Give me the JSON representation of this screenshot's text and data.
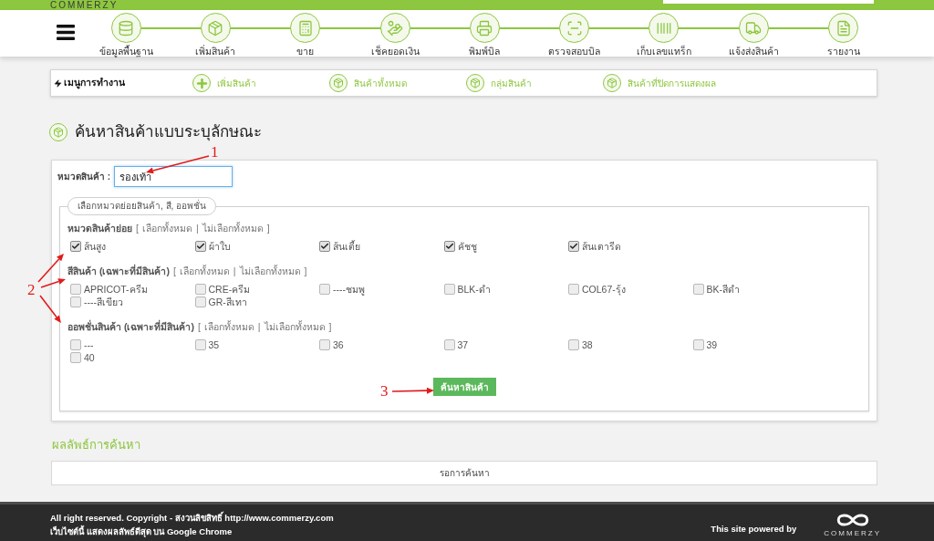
{
  "top_bar": {
    "logo": "COMMERZY"
  },
  "nav": {
    "items": [
      {
        "label": "ข้อมูลพื้นฐาน"
      },
      {
        "label": "เพิ่มสินค้า"
      },
      {
        "label": "ขาย"
      },
      {
        "label": "เช็คยอดเงิน"
      },
      {
        "label": "พิมพ์บิล"
      },
      {
        "label": "ตรวจสอบบิล"
      },
      {
        "label": "เก็บเลขแทร็ก"
      },
      {
        "label": "แจ้งส่งสินค้า"
      },
      {
        "label": "รายงาน"
      }
    ]
  },
  "work_menu": {
    "title": "เมนูการทำงาน",
    "items": [
      {
        "label": "เพิ่มสินค้า",
        "kind": "add"
      },
      {
        "label": "สินค้าทั้งหมด",
        "kind": "box"
      },
      {
        "label": "กลุ่มสินค้า",
        "kind": "box"
      },
      {
        "label": "สินค้าที่ปิดการแสดงผล",
        "kind": "box"
      }
    ]
  },
  "page_title": "ค้นหาสินค้าแบบระบุลักษณะ",
  "form": {
    "category_label": "หมวดสินค้า :",
    "category_value": "รองเท้า",
    "legend": "เลือกหมวดย่อยสินค้า, สี, ออพชั่น",
    "sections": [
      {
        "title": "หมวดสินค้าย่อย",
        "brackets": [
          "[",
          "|",
          "]"
        ],
        "select_all": "เลือกทั้งหมด",
        "select_none": "ไม่เลือกทั้งหมด",
        "options": [
          {
            "label": "ส้นสูง",
            "checked": true
          },
          {
            "label": "ผ้าใบ",
            "checked": true
          },
          {
            "label": "ส้นเตี้ย",
            "checked": true
          },
          {
            "label": "คัชชู",
            "checked": true
          },
          {
            "label": "ส้นเตารีด",
            "checked": true
          }
        ]
      },
      {
        "title": "สีสินค้า (เฉพาะที่มีสินค้า)",
        "brackets": [
          "[",
          "|",
          "]"
        ],
        "select_all": "เลือกทั้งหมด",
        "select_none": "ไม่เลือกทั้งหมด",
        "options": [
          {
            "label": "APRICOT-ครีม",
            "checked": false
          },
          {
            "label": "CRE-ครีม",
            "checked": false
          },
          {
            "label": "----ชมพู",
            "checked": false
          },
          {
            "label": "BLK-ดำ",
            "checked": false
          },
          {
            "label": "COL67-รุ้ง",
            "checked": false
          },
          {
            "label": "BK-สีดำ",
            "checked": false
          },
          {
            "label": "----สีเขียว",
            "checked": false
          },
          {
            "label": "GR-สีเทา",
            "checked": false
          }
        ]
      },
      {
        "title": "ออพชั่นสินค้า (เฉพาะที่มีสินค้า)",
        "brackets": [
          "[",
          "|",
          "]"
        ],
        "select_all": "เลือกทั้งหมด",
        "select_none": "ไม่เลือกทั้งหมด",
        "options": [
          {
            "label": "---",
            "checked": false
          },
          {
            "label": "35",
            "checked": false
          },
          {
            "label": "36",
            "checked": false
          },
          {
            "label": "37",
            "checked": false
          },
          {
            "label": "38",
            "checked": false
          },
          {
            "label": "39",
            "checked": false
          },
          {
            "label": "40",
            "checked": false
          }
        ]
      }
    ],
    "submit": "ค้นหาสินค้า"
  },
  "results": {
    "title": "ผลลัพธ์การค้นหา",
    "status": "รอการค้นหา"
  },
  "footer": {
    "lines": [
      "All right reserved. Copyright - สงวนลิขสิทธิ์ http://www.commerzy.com",
      "เว็บไซต์นี้ แสดงผลลัพธ์ดีสุด บน Google Chrome"
    ],
    "powered_by": "This site powered by",
    "logo": "COMMERZY"
  },
  "annotations": [
    {
      "label": "1"
    },
    {
      "label": "2"
    },
    {
      "label": "3"
    }
  ]
}
